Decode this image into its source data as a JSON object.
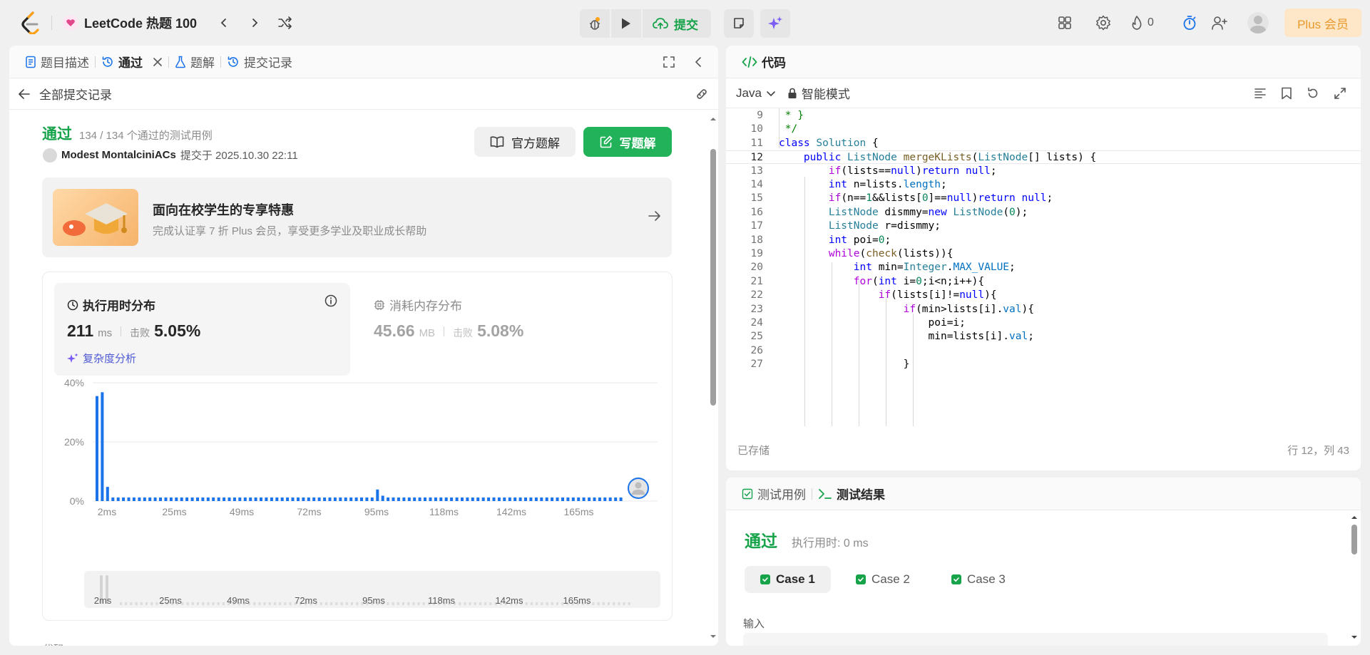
{
  "topbar": {
    "list_title": "LeetCode 热题 100",
    "submit_label": "提交",
    "streak_count": "0",
    "plus_label": "Plus 会员"
  },
  "left": {
    "tabs": [
      {
        "label": "题目描述"
      },
      {
        "label": "通过"
      },
      {
        "label": "题解"
      },
      {
        "label": "提交记录"
      }
    ],
    "back_label": "全部提交记录",
    "result": {
      "status": "通过",
      "count": "134 / 134 个通过的测试用例",
      "user": "Modest MontalciniACs",
      "submitted_at": "提交于 2025.10.30 22:11"
    },
    "official_solution": "官方题解",
    "write_solution": "写题解",
    "promo": {
      "title": "面向在校学生的专享特惠",
      "subtitle": "完成认证享 7 折 Plus 会员，享受更多学业及职业成长帮助"
    },
    "runtime": {
      "title": "执行用时分布",
      "value": "211",
      "unit": "ms",
      "beat_label": "击败",
      "beat_value": "5.05%",
      "complexity": "复杂度分析"
    },
    "memory": {
      "title": "消耗内存分布",
      "value": "45.66",
      "unit": "MB",
      "beat_label": "击败",
      "beat_value": "5.08%"
    },
    "cut_text": "代码"
  },
  "chart_data": {
    "type": "bar",
    "ylim": [
      0,
      40
    ],
    "y_ticks": [
      "40%",
      "20%",
      "0%"
    ],
    "x_ticks": [
      "2ms",
      "25ms",
      "49ms",
      "72ms",
      "95ms",
      "118ms",
      "142ms",
      "165ms"
    ],
    "slider_ticks": [
      "2ms",
      "25ms",
      "49ms",
      "72ms",
      "95ms",
      "118ms",
      "142ms",
      "165ms"
    ],
    "values": [
      35.5,
      36.8,
      4.8,
      1.2,
      1.2,
      1.2,
      1.2,
      1.2,
      1.2,
      1.2,
      1.2,
      1.2,
      1.2,
      1.2,
      1.2,
      1.2,
      1.2,
      1.2,
      1.2,
      1.2,
      1.2,
      1.2,
      1.2,
      1.2,
      1.2,
      1.2,
      1.2,
      1.2,
      1.2,
      1.2,
      1.2,
      1.2,
      1.2,
      1.2,
      1.2,
      1.2,
      1.2,
      1.2,
      1.2,
      1.2,
      1.2,
      1.2,
      1.2,
      1.2,
      1.2,
      1.2,
      1.2,
      1.2,
      1.2,
      1.2,
      1.2,
      1.2,
      1.2,
      3.9,
      1.8,
      1.2,
      1.2,
      1.2,
      1.2,
      1.2,
      1.2,
      1.2,
      1.2,
      1.2,
      1.2,
      1.2,
      1.2,
      1.2,
      1.2,
      1.2,
      1.2,
      1.2,
      1.2,
      1.2,
      1.2,
      1.2,
      1.2,
      1.2,
      1.2,
      1.2,
      1.2,
      1.2,
      1.2,
      1.2,
      1.2,
      1.2,
      1.2,
      1.2,
      1.2,
      1.2,
      1.2,
      1.2,
      1.2,
      1.2,
      1.2,
      1.2,
      1.2,
      1.2,
      1.2,
      1.2
    ],
    "bar_color": "#1a73e8",
    "grid": true
  },
  "code": {
    "title": "代码",
    "language": "Java",
    "mode": "智能模式",
    "saved": "已存储",
    "cursor": "行 12，列 43",
    "lines": [
      {
        "n": "9",
        "t": " * }"
      },
      {
        "n": "10",
        "t": " */"
      },
      {
        "n": "11",
        "t": "class Solution {"
      },
      {
        "n": "12",
        "t": "    public ListNode mergeKLists(ListNode[] lists) {"
      },
      {
        "n": "13",
        "t": "        if(lists==null)return null;"
      },
      {
        "n": "14",
        "t": "        int n=lists.length;"
      },
      {
        "n": "15",
        "t": "        if(n==1&&lists[0]==null)return null;"
      },
      {
        "n": "16",
        "t": "        ListNode dismmy=new ListNode(0);"
      },
      {
        "n": "17",
        "t": "        ListNode r=dismmy;"
      },
      {
        "n": "18",
        "t": "        int poi=0;"
      },
      {
        "n": "19",
        "t": "        while(check(lists)){"
      },
      {
        "n": "20",
        "t": "            int min=Integer.MAX_VALUE;"
      },
      {
        "n": "21",
        "t": "            for(int i=0;i<n;i++){"
      },
      {
        "n": "22",
        "t": "                if(lists[i]!=null){"
      },
      {
        "n": "23",
        "t": "                    if(min>lists[i].val){"
      },
      {
        "n": "24",
        "t": "                        poi=i;"
      },
      {
        "n": "25",
        "t": "                        min=lists[i].val;"
      },
      {
        "n": "26",
        "t": ""
      },
      {
        "n": "27",
        "t": "                    }"
      }
    ]
  },
  "test": {
    "tab_cases": "测试用例",
    "tab_result": "测试结果",
    "status": "通过",
    "runtime": "执行用时: 0 ms",
    "cases": [
      "Case 1",
      "Case 2",
      "Case 3"
    ],
    "input_label": "输入"
  },
  "colors": {
    "accent_green": "#16a34a",
    "bar_blue": "#1a73e8",
    "plus_orange": "#e89a2c"
  }
}
